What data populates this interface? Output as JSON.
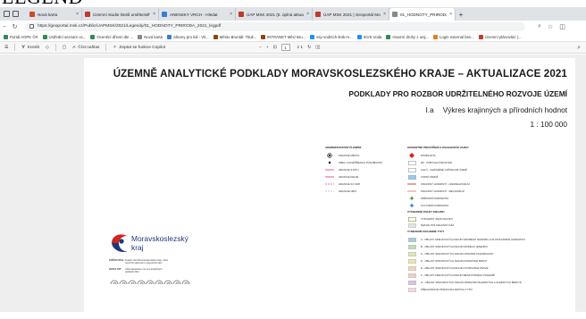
{
  "overlay_heading": "LEGEND",
  "tabs": [
    {
      "label": "Nová karta",
      "color": "#d24726"
    },
    {
      "label": "Územní studie limitů uměleckého...",
      "color": "#c0392b"
    },
    {
      "label": "ANENSKY VRCH - Hledat",
      "color": "#3a7bd5"
    },
    {
      "label": "ÚAP MSK 2021 (5. úplná aktualiz...",
      "color": "#c0392b"
    },
    {
      "label": "ÚAP MSK 2021 | Geoportál Mora...",
      "color": "#c0392b"
    },
    {
      "label": "01_HODNOTY_PRIRODA_2021_le...",
      "color": "#888888",
      "active": true
    }
  ],
  "address": {
    "url": "https://geoportal.msk.cz/Public/UAPMSK/2021/Legendy/01_HODNOTY_PRIRODA_2021_legpdf"
  },
  "bookmarks": [
    {
      "label": "Portál AOPK ČR",
      "color": "#2e8b57"
    },
    {
      "label": "Ústřední seznam oc...",
      "color": "#2e8b57"
    },
    {
      "label": "Ocenění dřevin dle ...",
      "color": "#2e8b57"
    },
    {
      "label": "Nová karta",
      "color": "#888888"
    },
    {
      "label": "zákony pro lidi - Vit...",
      "color": "#3a7bd5"
    },
    {
      "label": "Město Bruntál: Tituli...",
      "color": "#8b4513"
    },
    {
      "label": "INTRANET MěÚ Bru...",
      "color": "#8b4513"
    },
    {
      "label": "ssy-vodních-linik-m...",
      "color": "#1e90ff"
    },
    {
      "label": "ISVS Voda",
      "color": "#1e90ff"
    },
    {
      "label": "Invazní druhy z unij...",
      "color": "#2e8b57"
    },
    {
      "label": "Login external ben...",
      "color": "#e08020"
    },
    {
      "label": "Územní plánování |...",
      "color": "#c0392b"
    }
  ],
  "pdf_toolbar": {
    "draw": "Kreslit",
    "read_aloud": "Číst nahlas",
    "copilot": "Zeptat se funkce Copilot",
    "page_current": "1",
    "page_total": "z 1"
  },
  "document": {
    "title": "ÚZEMNĚ ANALYTICKÉ PODKLADY MORAVSKOSLEZSKÉHO KRAJE – AKTUALIZACE 2021",
    "subtitle": "PODKLADY PRO ROZBOR UDRŽITELNÉHO ROZVOJE ÚZEMÍ",
    "map_code": "I.a",
    "map_name": "Výkres krajinných a přírodních hodnot",
    "scale": "1 : 100 000"
  },
  "legend_admin": {
    "title": "ADMINISTRATIVNÍ ČLENĚNÍ",
    "items": [
      {
        "label": "KRAJSKÉ MĚSTO",
        "sym": "dot-big"
      },
      {
        "label": "OBEC S ROZŠÍŘENOU PŮSOBNOSTÍ",
        "sym": "dot-small"
      },
      {
        "label": "HRANICE STÁTU",
        "sym": "line",
        "color": "#d14fa3"
      },
      {
        "label": "HRANICE KRAJE",
        "sym": "line",
        "color": "#d14fa3"
      },
      {
        "label": "HRANICE SO ORP",
        "sym": "dash",
        "color": "#d14fa3"
      },
      {
        "label": "HRANICE OBCÍ",
        "sym": "dash",
        "color": "#d9a0c8"
      }
    ]
  },
  "legend_nature": {
    "title": "HODNOTNÉ PROSTŘEDÍ A POHLEDOVÉ VAZBY",
    "items": [
      {
        "label": "DOMINANTA",
        "sym": "diamond",
        "color": "#d0271d"
      },
      {
        "label": "DP - DOBÝVACÍ PROSTOR",
        "sym": "box",
        "color": "#ffffff",
        "border": "#999999"
      },
      {
        "label": "CHLÚ - CHRÁNĚNÉ LOŽISKOVÉ ÚZEMÍ",
        "sym": "box",
        "color": "#ffffff",
        "border": "#999999"
      },
      {
        "label": "VODNÍ NÁDRŽ",
        "sym": "box",
        "color": "#9ec9ec",
        "border": "#7aa8cc"
      },
      {
        "label": "KRAJINNÝ HORIZONT - NADREGIONÁLNÍ",
        "sym": "line",
        "color": "#c0392b"
      },
      {
        "label": "KRAJINNÝ HORIZONT - REGIONÁLNÍ",
        "sym": "line",
        "color": "#e07a7a"
      },
      {
        "label": "PŘÍRODNÍ DOMINANTA",
        "sym": "star",
        "color": "#2e9a2e"
      },
      {
        "label": "KULTURNÍ DOMINANTA",
        "sym": "star",
        "color": "#2a6fd1"
      }
    ]
  },
  "legend_landscape": {
    "title": "VÝZNAMNÉ ZNAKY KRAJINY",
    "items": [
      {
        "label": "VÝZNAMNÝ ZNAK KRAJINY",
        "sym": "box",
        "color": "#ffffff",
        "border": "#7c9a3a"
      },
      {
        "label": "NEKVALITNÍ KRAJINNÝ RÁZ",
        "sym": "box",
        "color": "#e5e5e5",
        "border": "#bbbbbb"
      }
    ]
  },
  "legend_types": {
    "title": "VYMEZENÉ KRAJINNÉ TYPY",
    "items": [
      {
        "label": "A - OBLAST SPECIFICKÝCH KRAJIN HRUBÉHO JESENÍKU A ZLATOHORSKÉ HORNATINY",
        "color": "#a9cbd6"
      },
      {
        "label": "B - OBLAST SPECIFICKÝCH KRAJIN NÍZKÉHO JESENÍKU",
        "color": "#c5dbb2"
      },
      {
        "label": "C - OBLAST SPECIFICKÝCH KRAJIN OPAVSKÉ PAHORKATINY",
        "color": "#dfe6b5"
      },
      {
        "label": "D - OBLAST SPECIFICKÝCH KRAJIN MORAVSKÉ BRÁNY",
        "color": "#ede4b3"
      },
      {
        "label": "E - OBLAST SPECIFICKÝCH KRAJIN OSTRAVSKÉ PÁNVE",
        "color": "#f3d7b8"
      },
      {
        "label": "F - OBLAST SPECIFICKÝCH KRAJIN BESKYDSKÉHO PODHŮŘÍ",
        "color": "#efcfc8"
      },
      {
        "label": "G - OBLAST SPECIFICKÝCH KRAJIN MORAVSKOSLEZSKÝCH A SLEZSKÝCH BESKYD",
        "color": "#d9c4dd"
      },
      {
        "label": "PŘECHODOVÉ PÁSMO KRAJINNÝCH TYPŮ",
        "color": "#f6d8de"
      }
    ]
  },
  "logo": {
    "line1": "Moravskoslezský",
    "line2": "kraj"
  },
  "meta": {
    "producer_label": "POŘIZOVATEL:",
    "producer_value": "Krajský úřad Moravskoslezského kraje, odbor územního plánování a stavebního řádu",
    "data_label": "ZDROJ DAT:",
    "data_value": "Úplná aktualizace územně analytických podkladů 2021"
  },
  "colors": {
    "tabstrip": "#dfe3e8",
    "viewer_bg": "#eeeeee",
    "logo_blue": "#1f3a7a",
    "logo_red": "#d0271d"
  }
}
